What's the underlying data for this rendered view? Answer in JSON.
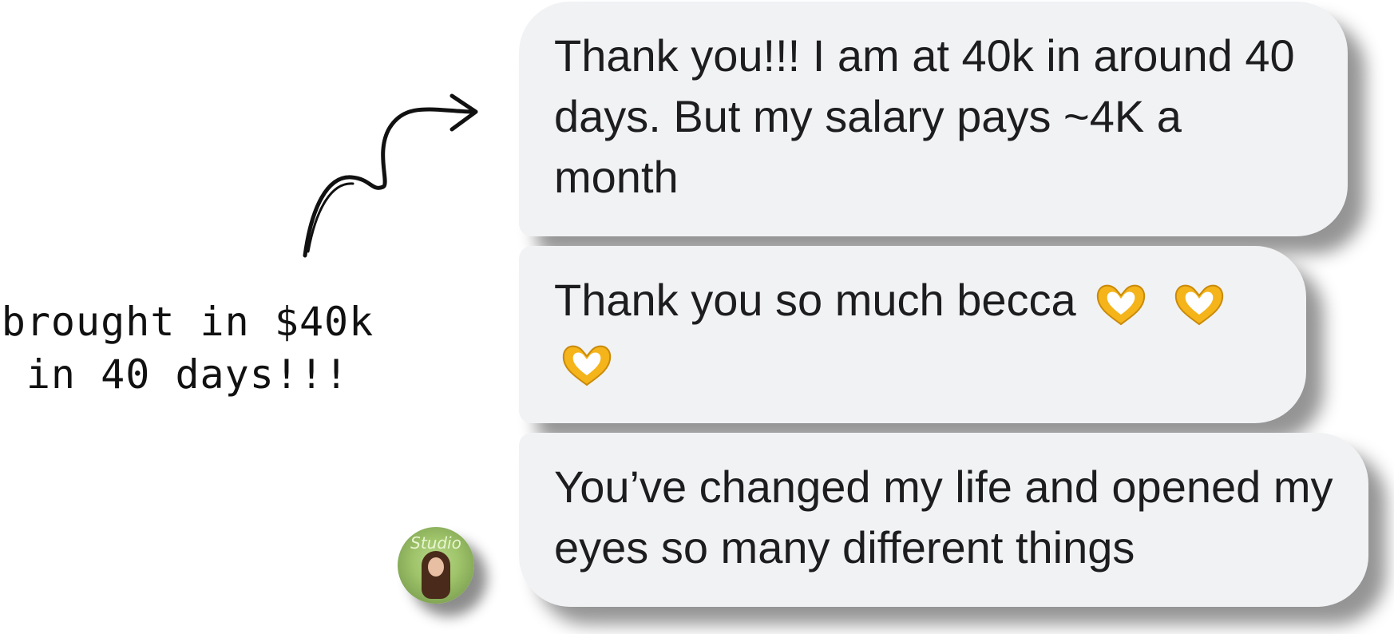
{
  "messages": [
    {
      "text": "Thank you!!! I am at 40k in around 40 days. But my salary pays ~4K a month"
    },
    {
      "text": "Thank you so much becca",
      "emojis": [
        "heart-hands-emoji",
        "heart-hands-emoji",
        "heart-hands-emoji"
      ]
    },
    {
      "text": "You’ve changed my life and opened my eyes so many different things"
    }
  ],
  "annotation": {
    "line1": "brought in $40k",
    "line2": "in 40 days!!!"
  },
  "avatar": {
    "label": "Studio",
    "icon": "profile-avatar"
  },
  "colors": {
    "bubble": "#f1f2f4",
    "text": "#1d1d1f",
    "emoji": "#f4b41a",
    "ink": "#111111"
  }
}
